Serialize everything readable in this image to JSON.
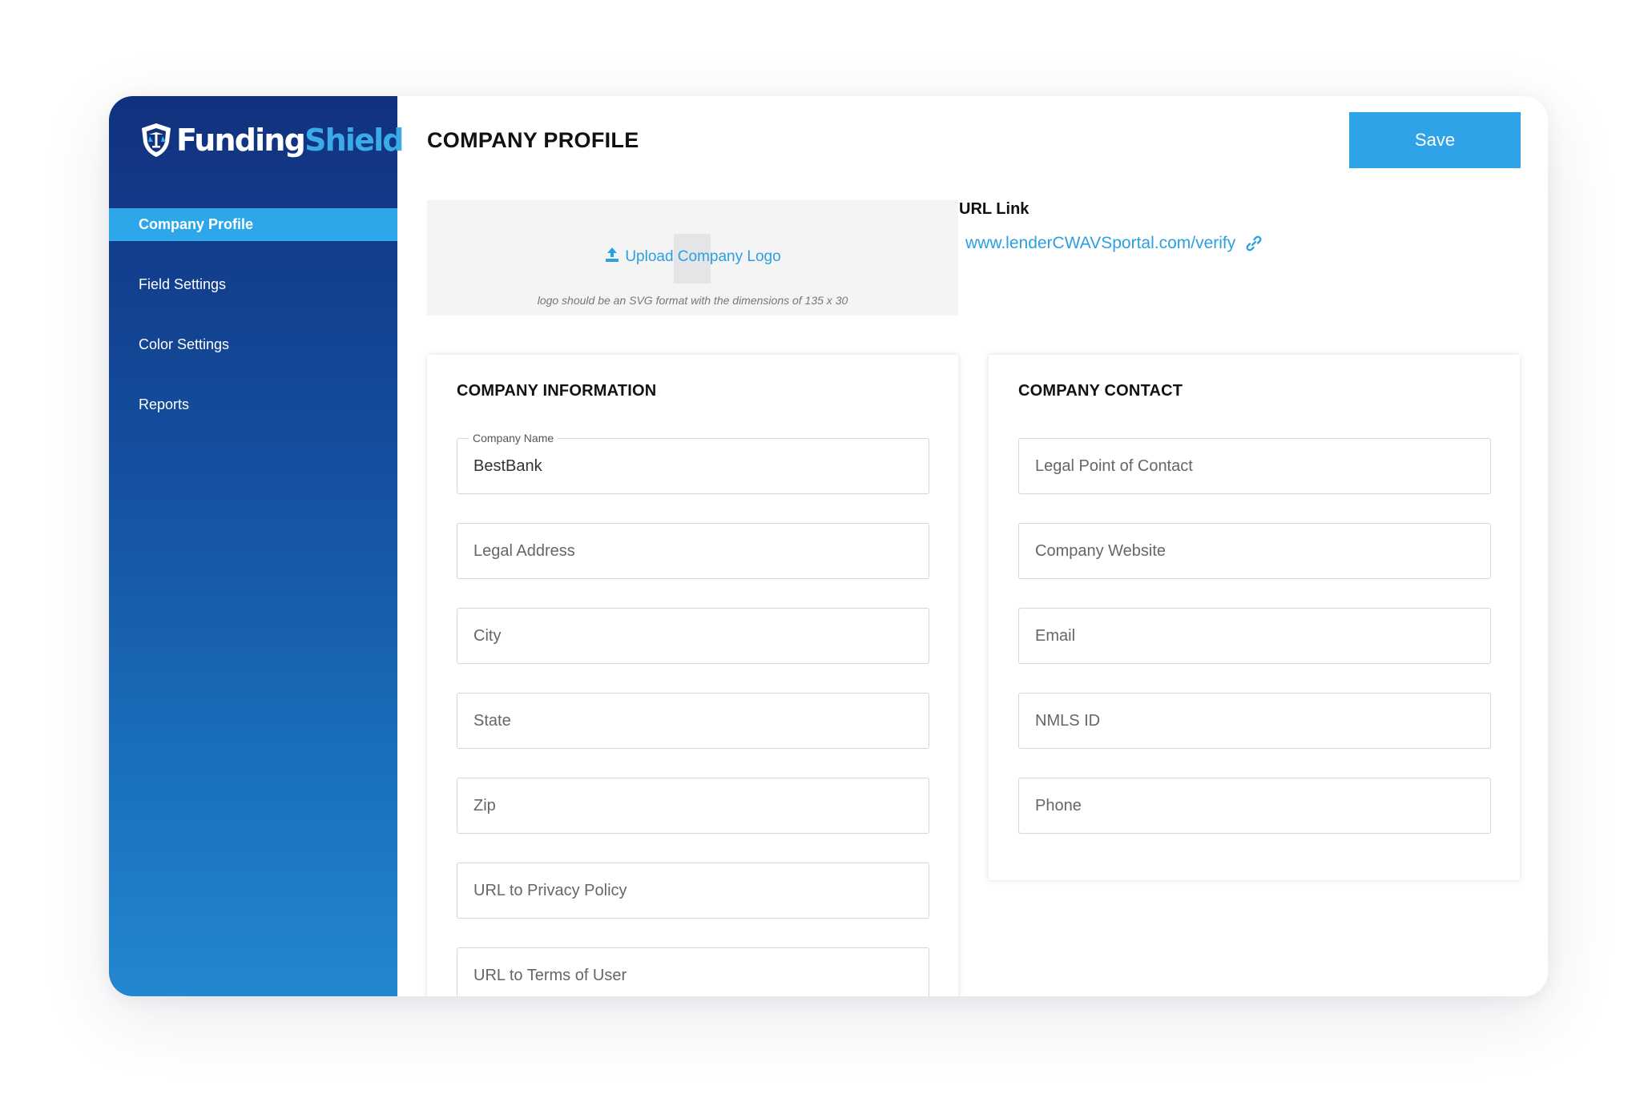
{
  "brand": {
    "name_part1": "Funding",
    "name_part2": "Shield"
  },
  "sidebar": {
    "items": [
      {
        "label": "Company Profile",
        "active": true
      },
      {
        "label": "Field Settings"
      },
      {
        "label": "Color Settings"
      },
      {
        "label": "Reports"
      }
    ]
  },
  "header": {
    "title": "COMPANY PROFILE",
    "save_label": "Save"
  },
  "upload": {
    "link_label": "Upload Company Logo",
    "hint": "logo should be an SVG format with the dimensions of 135 x 30"
  },
  "url_section": {
    "label": "URL Link",
    "url": "www.lenderCWAVSportal.com/verify"
  },
  "company_information": {
    "title": "COMPANY INFORMATION",
    "company_name": {
      "label": "Company Name",
      "value": "BestBank"
    },
    "fields": [
      {
        "placeholder": "Legal Address"
      },
      {
        "placeholder": "City"
      },
      {
        "placeholder": "State"
      },
      {
        "placeholder": "Zip"
      },
      {
        "placeholder": "URL to Privacy Policy"
      },
      {
        "placeholder": "URL to Terms of User"
      }
    ]
  },
  "company_contact": {
    "title": "COMPANY CONTACT",
    "fields": [
      {
        "placeholder": "Legal Point of Contact"
      },
      {
        "placeholder": "Company Website"
      },
      {
        "placeholder": "Email"
      },
      {
        "placeholder": "NMLS ID"
      },
      {
        "placeholder": "Phone"
      }
    ]
  },
  "colors": {
    "sidebar_top": "#11317e",
    "sidebar_bottom": "#2387d0",
    "accent": "#2ea3e8",
    "link": "#2a9fe2"
  }
}
